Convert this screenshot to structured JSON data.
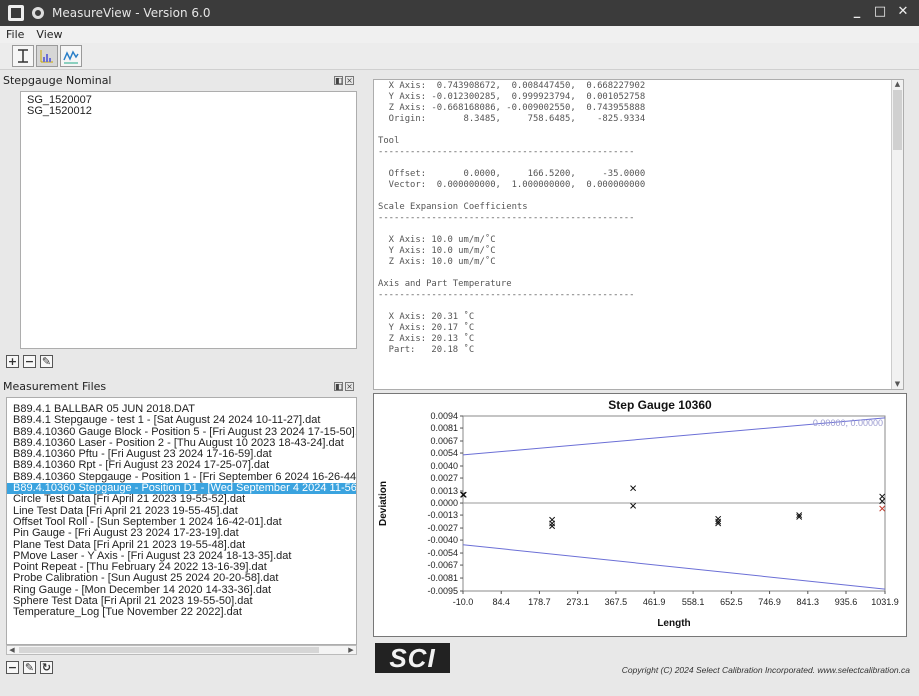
{
  "window": {
    "title": "MeasureView - Version 6.0"
  },
  "menu": [
    {
      "label": "File"
    },
    {
      "label": "View"
    }
  ],
  "stepgauge_panel": {
    "title": "Stepgauge Nominal",
    "items": [
      "SG_1520007",
      "SG_1520012"
    ]
  },
  "measurement_panel": {
    "title": "Measurement Files",
    "selected_index": 7,
    "files": [
      "B89.4.1 BALLBAR 05 JUN 2018.DAT",
      "B89.4.1 Stepgauge - test 1 -  [Sat August 24 2024 10-11-27].dat",
      "B89.4.10360 Gauge Block - Position 5 -  [Fri August 23 2024 17-15-50].dat",
      "B89.4.10360 Laser - Position 2 -  [Thu August 10 2023 18-43-24].dat",
      "B89.4.10360 Pftu -  [Fri August 23 2024 17-16-59].dat",
      "B89.4.10360 Rpt -  [Fri August 23 2024 17-25-07].dat",
      "B89.4.10360 Stepgauge - Position 1 -  [Fri September 6 2024 16-26-44].dat",
      "B89.4.10360 Stepgauge - Position D1 -  [Wed September 4 2024 11-56-28].dat",
      "Circle Test Data [Fri April 21 2023 19-55-52].dat",
      "Line Test Data [Fri April 21 2023 19-55-45].dat",
      "Offset Tool Roll -  [Sun September 1 2024 16-42-01].dat",
      "Pin Gauge -  [Fri August 23 2024 17-23-19].dat",
      "Plane Test Data [Fri April 21 2023 19-55-48].dat",
      "PMove Laser - Y Axis -  [Fri August 23 2024 18-13-35].dat",
      "Point Repeat -  [Thu February 24 2022 13-16-39].dat",
      "Probe Calibration -  [Sun August 25 2024 20-20-58].dat",
      "Ring Gauge -  [Mon December 14 2020 14-33-36].dat",
      "Sphere Test Data [Fri April 21 2023 19-55-50].dat",
      "Temperature_Log [Tue November 22 2022].dat"
    ]
  },
  "report_text": [
    "  X Axis:  0.743908672,  0.008447450,  0.668227902",
    "  Y Axis: -0.012300285,  0.999923794,  0.001052758",
    "  Z Axis: -0.668168086, -0.009002550,  0.743955888",
    "  Origin:       8.3485,     758.6485,    -825.9334",
    "",
    "Tool",
    "------------------------------------------------",
    "",
    "  Offset:       0.0000,     166.5200,     -35.0000",
    "  Vector:  0.000000000,  1.000000000,  0.000000000",
    "",
    "Scale Expansion Coefficients",
    "------------------------------------------------",
    "",
    "  X Axis: 10.0 um/m/˚C",
    "  Y Axis: 10.0 um/m/˚C",
    "  Z Axis: 10.0 um/m/˚C",
    "",
    "Axis and Part Temperature",
    "------------------------------------------------",
    "",
    "  X Axis: 20.31 ˚C",
    "  Y Axis: 20.17 ˚C",
    "  Z Axis: 20.13 ˚C",
    "  Part:   20.18 ˚C"
  ],
  "chart_data": {
    "type": "scatter",
    "title": "Step Gauge 10360",
    "xlabel": "Length",
    "ylabel": "Deviation",
    "xlim": [
      -10.0,
      1031.9
    ],
    "ylim": [
      -0.0095,
      0.0094
    ],
    "x_ticks": [
      "-10.0",
      "84.4",
      "178.7",
      "273.1",
      "367.5",
      "461.9",
      "558.1",
      "652.5",
      "746.9",
      "841.3",
      "935.6",
      "1031.9"
    ],
    "y_ticks": [
      "0.0094",
      "0.0081",
      "0.0067",
      "0.0054",
      "0.0040",
      "0.0027",
      "0.0013",
      "0.0000",
      "-0.0013",
      "-0.0027",
      "-0.0040",
      "-0.0054",
      "-0.0067",
      "-0.0081",
      "-0.0095"
    ],
    "legend_text": "0.00000,  0.00000",
    "limit_upper": [
      [
        -10.0,
        0.0052
      ],
      [
        1031.9,
        0.0092
      ]
    ],
    "limit_lower": [
      [
        -10.0,
        -0.0045
      ],
      [
        1031.9,
        -0.0093
      ]
    ],
    "points_black": [
      [
        -10.0,
        0.0009
      ],
      [
        -8.0,
        0.0009
      ],
      [
        210.0,
        -0.0018
      ],
      [
        210.0,
        -0.0022
      ],
      [
        210.0,
        -0.0025
      ],
      [
        410.0,
        0.0016
      ],
      [
        410.0,
        -0.0003
      ],
      [
        620.0,
        -0.0017
      ],
      [
        620.0,
        -0.002
      ],
      [
        620.0,
        -0.0022
      ],
      [
        820.0,
        -0.0013
      ],
      [
        820.0,
        -0.0015
      ],
      [
        1025.0,
        0.0007
      ],
      [
        1025.0,
        0.0002
      ]
    ],
    "points_red": [
      [
        1025.0,
        -0.0006
      ]
    ]
  },
  "footer": {
    "logo_text": "SCI",
    "copyright": "Copyright (C) 2024 Select Calibration Incorporated.  www.selectcalibration.ca"
  },
  "colors": {
    "selection": "#3aa3df",
    "limit_line": "#6b6fd6",
    "titlebar": "#3b3b3b"
  }
}
